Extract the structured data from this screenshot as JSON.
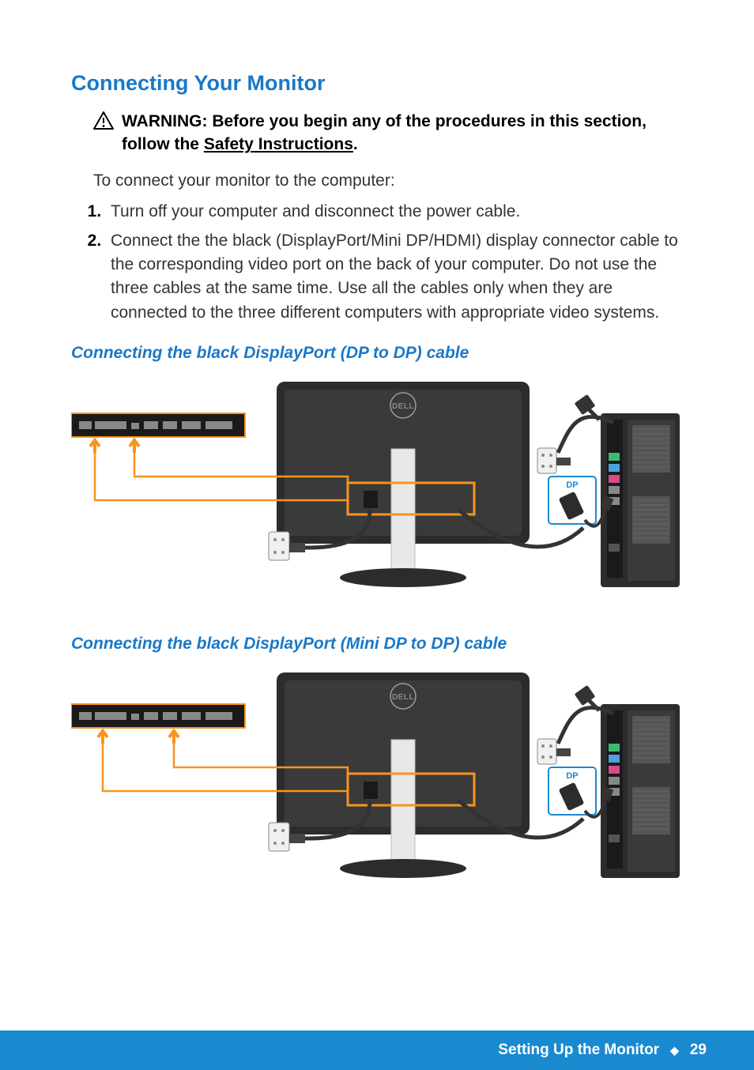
{
  "title": "Connecting Your Monitor",
  "warning": {
    "prefix": "WARNING:",
    "body_before_link": " Before you begin any of the procedures in this section, follow the ",
    "link_text": "Safety Instructions",
    "body_after_link": "."
  },
  "intro": "To connect your monitor to the computer:",
  "steps": [
    "Turn off your computer and disconnect the power cable.",
    "Connect the the black (DisplayPort/Mini DP/HDMI) display connector cable to the corresponding video port on the back of your computer. Do not use the three cables at the same time. Use all the cables only when they are connected to the three different computers with appropriate video systems."
  ],
  "subheading_1": "Connecting the black DisplayPort (DP to DP) cable",
  "subheading_2": "Connecting the black DisplayPort (Mini DP to DP) cable",
  "diagram_labels": {
    "dp": "DP",
    "brand": "DELL"
  },
  "footer": {
    "section": "Setting Up the Monitor",
    "page": "29"
  }
}
